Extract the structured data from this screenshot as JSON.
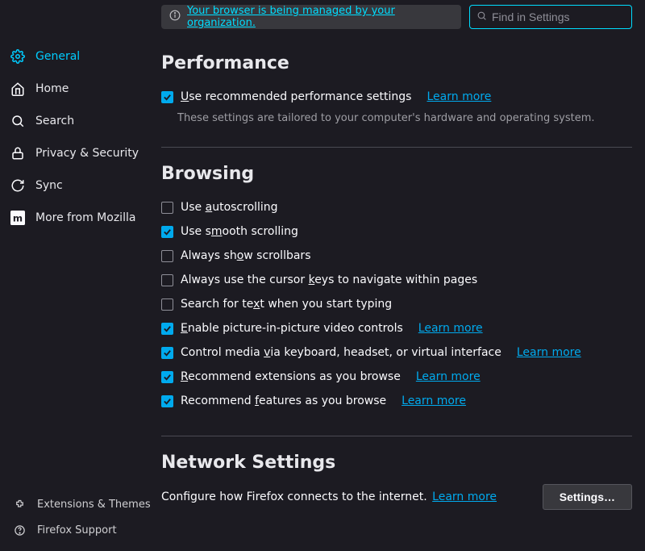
{
  "notice": "Your browser is being managed by your organization.",
  "search_placeholder": "Find in Settings",
  "sidebar": {
    "items": [
      {
        "label": "General"
      },
      {
        "label": "Home"
      },
      {
        "label": "Search"
      },
      {
        "label": "Privacy & Security"
      },
      {
        "label": "Sync"
      },
      {
        "label": "More from Mozilla"
      }
    ],
    "footer": [
      {
        "label": "Extensions & Themes"
      },
      {
        "label": "Firefox Support"
      }
    ]
  },
  "performance": {
    "heading": "Performance",
    "recommend": "Use recommended performance settings",
    "learn": "Learn more",
    "desc": "These settings are tailored to your computer's hardware and operating system."
  },
  "browsing": {
    "heading": "Browsing",
    "autoscroll": "Use autoscrolling",
    "smooth": "Use smooth scrolling",
    "scrollbars": "Always show scrollbars",
    "cursor": "Always use the cursor keys to navigate within pages",
    "searchtype": "Search for text when you start typing",
    "pip": "Enable picture-in-picture video controls",
    "media": "Control media via keyboard, headset, or virtual interface",
    "rec_ext": "Recommend extensions as you browse",
    "rec_feat": "Recommend features as you browse",
    "learn": "Learn more"
  },
  "network": {
    "heading": "Network Settings",
    "desc": "Configure how Firefox connects to the internet.",
    "learn": "Learn more",
    "button": "Settings…"
  }
}
